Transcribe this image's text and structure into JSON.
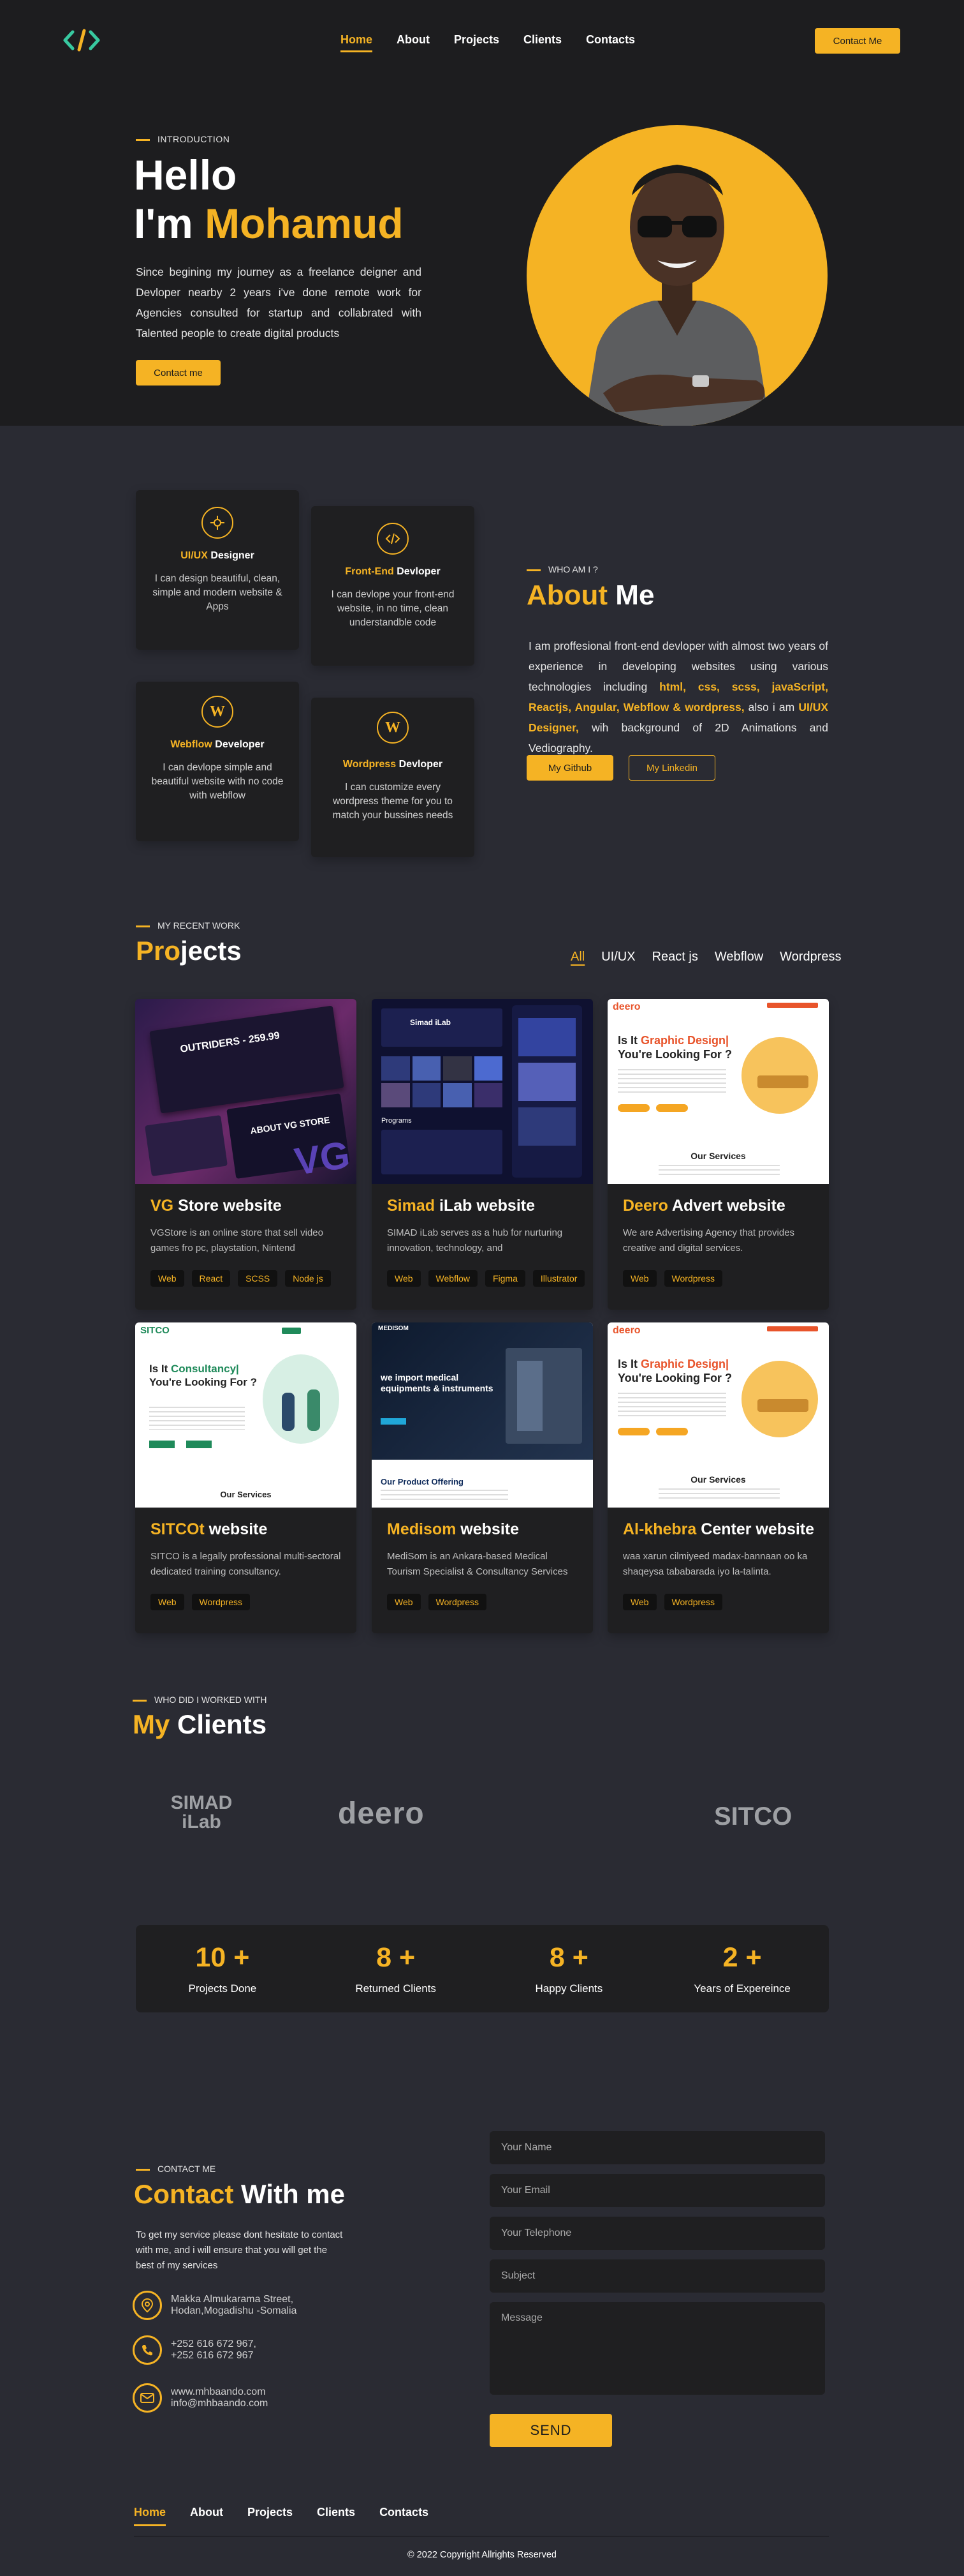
{
  "header": {
    "nav": [
      "Home",
      "About",
      "Projects",
      "Clients",
      "Contacts"
    ],
    "contact_button": "Contact Me"
  },
  "hero": {
    "label": "INTRODUCTION",
    "hello": "Hello",
    "im_prefix": "I'm ",
    "name": "Mohamud",
    "description": "Since begining my journey as a freelance deigner and Devloper nearby 2 years i've done remote work for Agencies consulted for startup and collabrated with Talented people to create digital products",
    "button": "Contact me"
  },
  "services": [
    {
      "icon": "pen-tool-icon",
      "title_accent": "UI/UX",
      "title_rest": " Designer",
      "description": "I can design beautiful, clean, simple and modern website & Apps"
    },
    {
      "icon": "code-icon",
      "title_accent": "Front-End",
      "title_rest": " Devloper",
      "description": "I can devlope your front-end website, in no time, clean understandble code"
    },
    {
      "icon": "webflow-icon",
      "title_accent": "Webflow",
      "title_rest": " Developer",
      "description": "I can devlope simple and beautiful website with no code with webflow"
    },
    {
      "icon": "wordpress-icon",
      "title_accent": "Wordpress",
      "title_rest": " Devloper",
      "description": "I can customize every wordpress theme for you to match your bussines needs"
    }
  ],
  "about": {
    "label": "WHO AM I ?",
    "title_accent": "About",
    "title_rest": " Me",
    "desc_1": "I am proffesional front-end devloper with almost two years of experience in developing websites using various technologies including ",
    "desc_tech": "html, css, scss, javaScript, Reactjs, Angular, Webflow & wordpress,",
    "desc_2": " also i am ",
    "desc_uiux": "UI/UX Designer,",
    "desc_3": " wih background of 2D Animations and Vediography.",
    "github_button": "My Github",
    "linkedin_button": "My Linkedin"
  },
  "projects": {
    "label": "MY RECENT WORK",
    "title_accent": "Pro",
    "title_rest": "jects",
    "filters": [
      "All",
      "UI/UX",
      "React js",
      "Webflow",
      "Wordpress"
    ],
    "items": [
      {
        "title_accent": "VG",
        "title_rest": " Store website",
        "description": "VGStore is an online store that sell video games fro pc, playstation, Nintend",
        "tags": [
          "Web",
          "React",
          "SCSS",
          "Node js"
        ],
        "image": {
          "heading": "OUTRIDERS - 259.99",
          "sub": "ABOUT VG STORE",
          "logo": "VG"
        }
      },
      {
        "title_accent": "Simad",
        "title_rest": " iLab website",
        "description": "SIMAD iLab serves as a hub for nurturing innovation, technology, and entrepreneurship",
        "tags": [
          "Web",
          "Webflow",
          "Figma",
          "Illustrator"
        ],
        "image": {
          "heading": "Simad iLab",
          "sub": "Programs"
        }
      },
      {
        "title_accent": "Deero",
        "title_rest": " Advert website",
        "description": "We are Advertising Agency that provides creative and digital services.",
        "tags": [
          "Web",
          "Wordpress"
        ],
        "image": {
          "logo": "deero",
          "heading_a": "Is It ",
          "heading_accent": "Graphic Design|",
          "heading_b": "You're Looking For ?",
          "sub": "Our Services"
        }
      },
      {
        "title_accent": "SITCOt",
        "title_rest": " website",
        "description": "SITCO is a legally professional multi-sectoral dedicated training consultancy.",
        "tags": [
          "Web",
          "Wordpress"
        ],
        "image": {
          "logo": "SITCO",
          "heading_a": "Is It ",
          "heading_accent": "Consultancy|",
          "heading_b": "You're Looking For ?",
          "sub": "Our Services"
        }
      },
      {
        "title_accent": "Medisom",
        "title_rest": "  website",
        "description": "MediSom is an Ankara-based Medical Tourism Specialist & Consultancy Services",
        "tags": [
          "Web",
          "Wordpress"
        ],
        "image": {
          "logo": "MEDISOM",
          "heading": "we import medical equipments & instruments",
          "sub": "Our Product Offering"
        }
      },
      {
        "title_accent": "Al-khebra",
        "title_rest": " Center website",
        "description": "waa xarun cilmiyeed madax-bannaan oo ka shaqeysa tababarada iyo la-talinta.",
        "tags": [
          "Web",
          "Wordpress"
        ],
        "image": {
          "logo": "deero",
          "heading_a": "Is It ",
          "heading_accent": "Graphic Design|",
          "heading_b": "You're Looking For ?",
          "sub": "Our Services"
        }
      }
    ]
  },
  "clients": {
    "label": "WHO DID I WORKED WITH",
    "title_accent": "My",
    "title_rest": " Clients",
    "logos": [
      "SIMAD iLab",
      "deero",
      "SITCO"
    ],
    "simad_top": "SIMAD",
    "simad_bottom": "iLab"
  },
  "stats": [
    {
      "value": "10 +",
      "label": "Projects Done"
    },
    {
      "value": "8 +",
      "label": "Returned Clients"
    },
    {
      "value": "8 +",
      "label": "Happy Clients"
    },
    {
      "value": "2 +",
      "label": "Years of Expereince"
    }
  ],
  "contact": {
    "label": "CONTACT ME",
    "title_accent": "Contact",
    "title_rest": " With me",
    "description": "To get my service please dont hesitate to contact with me, and i will ensure that you will get the best of my services",
    "address_1": "Makka Almukarama Street,",
    "address_2": "Hodan,Mogadishu -Somalia",
    "phone_1": "+252 616 672 967,",
    "phone_2": "+252 616 672 967",
    "web": "www.mhbaando.com",
    "email": "info@mhbaando.com",
    "placeholders": {
      "name": "Your Name",
      "email": "Your Email",
      "phone": "Your Telephone",
      "subject": "Subject",
      "message": "Message"
    },
    "send_button": "SEND"
  },
  "footer": {
    "nav": [
      "Home",
      "About",
      "Projects",
      "Clients",
      "Contacts"
    ],
    "copyright": "© 2022 Copyright Allrights Reserved"
  },
  "colors": {
    "accent": "#f5b324",
    "bg_dark": "#1d1d1f",
    "bg": "#2a2b33",
    "card": "#1f1f21"
  }
}
